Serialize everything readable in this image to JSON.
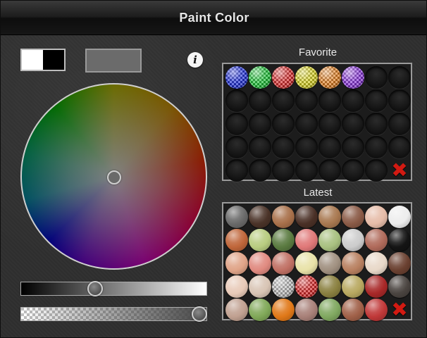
{
  "window": {
    "title": "Paint Color"
  },
  "colors": {
    "primary_swatch": "#ffffff",
    "secondary_swatch": "#000000",
    "current_color": "#6b6b6b"
  },
  "info_button": {
    "label": "i"
  },
  "brightness_level": 0.39,
  "opacity_level": 1.0,
  "favorite": {
    "title": "Favorite",
    "cells": [
      {
        "color": "#2333d8",
        "pattern": "checker"
      },
      {
        "color": "#22c23a",
        "pattern": "checker"
      },
      {
        "color": "#d83030",
        "pattern": "checker"
      },
      {
        "color": "#d6d024",
        "pattern": "checker"
      },
      {
        "color": "#e08024",
        "pattern": "checker"
      },
      {
        "color": "#8a38d8",
        "pattern": "checker"
      },
      null,
      null,
      null,
      null,
      null,
      null,
      null,
      null,
      null,
      null,
      null,
      null,
      null,
      null,
      null,
      null,
      null,
      null,
      null,
      null,
      null,
      null,
      null,
      null,
      null,
      null,
      null,
      null,
      null,
      null,
      null,
      null,
      null,
      {
        "delete": true
      }
    ]
  },
  "latest": {
    "title": "Latest",
    "cells": [
      {
        "color": "#6a6a6a"
      },
      {
        "color": "#4a3328"
      },
      {
        "color": "#a8704a"
      },
      {
        "color": "#4a3026"
      },
      {
        "color": "#a87850"
      },
      {
        "color": "#8a5a46"
      },
      {
        "color": "#e6bca8"
      },
      {
        "color": "#ededed"
      },
      {
        "color": "#c0663a"
      },
      {
        "color": "#b8cc80"
      },
      {
        "color": "#5a7a40"
      },
      {
        "color": "#e07878"
      },
      {
        "color": "#a8c080"
      },
      {
        "color": "#cccccc"
      },
      {
        "color": "#b06a5a"
      },
      {
        "color": "#141414"
      },
      {
        "color": "#e0a488"
      },
      {
        "color": "#e08a80"
      },
      {
        "color": "#c07064"
      },
      {
        "color": "#e8e2a8"
      },
      {
        "color": "#a09080"
      },
      {
        "color": "#b88060"
      },
      {
        "color": "#e8d8c8"
      },
      {
        "color": "#6a4030"
      },
      {
        "color": "#e8cab8"
      },
      {
        "color": "#d8c4b4"
      },
      {
        "color": "#bcbcbc",
        "pattern": "checker"
      },
      {
        "color": "#d82a2a",
        "pattern": "checker"
      },
      {
        "color": "#8a8040"
      },
      {
        "color": "#b8a860"
      },
      {
        "color": "#a82828"
      },
      {
        "color": "#4a4440"
      },
      {
        "color": "#c0a090"
      },
      {
        "color": "#80a858"
      },
      {
        "color": "#e07818"
      },
      {
        "color": "#a88078"
      },
      {
        "color": "#80a860"
      },
      {
        "color": "#a06048"
      },
      {
        "color": "#c03838"
      },
      {
        "delete": true
      }
    ]
  },
  "icons": {
    "info": "info-icon",
    "delete": "delete-x-icon"
  },
  "delete_glyph": "✖"
}
